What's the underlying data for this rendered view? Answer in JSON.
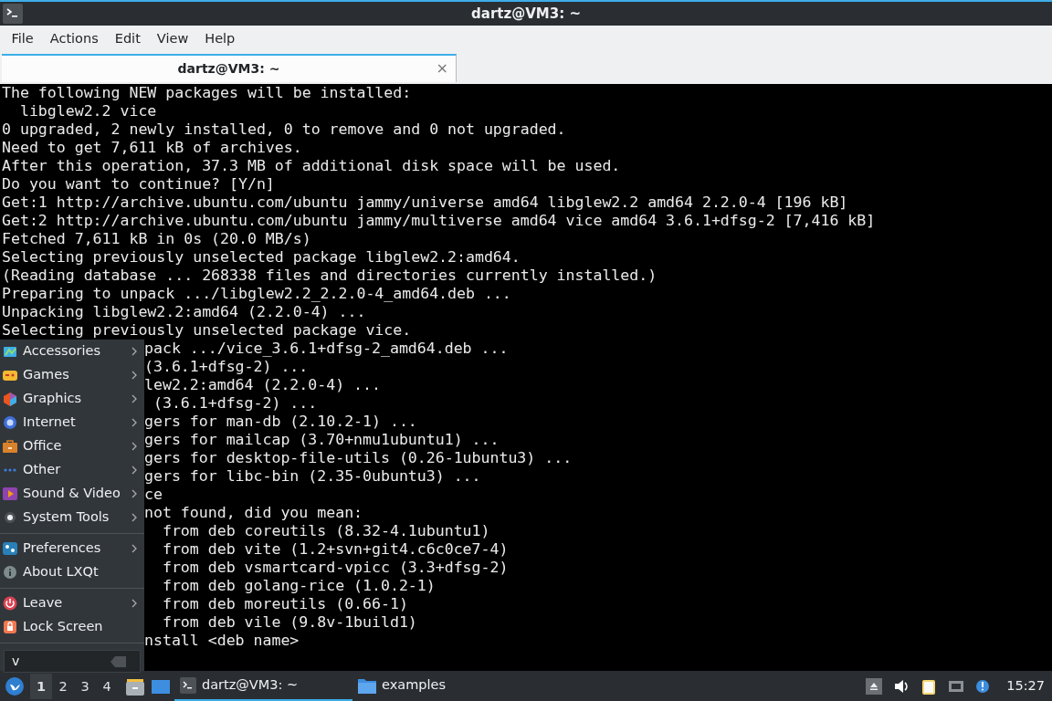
{
  "window": {
    "title": "dartz@VM3: ~"
  },
  "menubar": [
    "File",
    "Actions",
    "Edit",
    "View",
    "Help"
  ],
  "tabs": [
    {
      "label": "dartz@VM3: ~",
      "selected": true,
      "close": "×"
    }
  ],
  "terminal": {
    "lines": [
      "The following NEW packages will be installed:",
      "  libglew2.2 vice",
      "0 upgraded, 2 newly installed, 0 to remove and 0 not upgraded.",
      "Need to get 7,611 kB of archives.",
      "After this operation, 37.3 MB of additional disk space will be used.",
      "Do you want to continue? [Y/n]",
      "Get:1 http://archive.ubuntu.com/ubuntu jammy/universe amd64 libglew2.2 amd64 2.2.0-4 [196 kB]",
      "Get:2 http://archive.ubuntu.com/ubuntu jammy/multiverse amd64 vice amd64 3.6.1+dfsg-2 [7,416 kB]",
      "Fetched 7,611 kB in 0s (20.0 MB/s)",
      "Selecting previously unselected package libglew2.2:amd64.",
      "(Reading database ... 268338 files and directories currently installed.)",
      "Preparing to unpack .../libglew2.2_2.2.0-4_amd64.deb ...",
      "Unpacking libglew2.2:amd64 (2.2.0-4) ...",
      "Selecting previously unselected package vice."
    ],
    "partly_covered_lines": [
      "pack .../vice_3.6.1+dfsg-2_amd64.deb ...",
      "(3.6.1+dfsg-2) ...",
      "lew2.2:amd64 (2.2.0-4) ...",
      " (3.6.1+dfsg-2) ...",
      "gers for man-db (2.10.2-1) ...",
      "gers for mailcap (3.70+nmu1ubuntu1) ...",
      "gers for desktop-file-utils (0.26-1ubuntu3) ...",
      "gers for libc-bin (2.35-0ubuntu3) ...",
      "ce",
      "not found, did you mean:",
      "  from deb coreutils (8.32-4.1ubuntu1)",
      "  from deb vite (1.2+svn+git4.c6c0ce7-4)",
      "  from deb vsmartcard-vpicc (3.3+dfsg-2)",
      "  from deb golang-rice (1.0.2-1)",
      "  from deb moreutils (0.66-1)",
      "  from deb vile (9.8v-1build1)",
      "nstall <deb name>"
    ]
  },
  "start_menu": {
    "sections": [
      {
        "items": [
          {
            "label": "Accessories",
            "submenu": true
          },
          {
            "label": "Games",
            "submenu": true
          },
          {
            "label": "Graphics",
            "submenu": true
          },
          {
            "label": "Internet",
            "submenu": true
          },
          {
            "label": "Office",
            "submenu": true
          },
          {
            "label": "Other",
            "submenu": true
          },
          {
            "label": "Sound & Video",
            "submenu": true
          },
          {
            "label": "System Tools",
            "submenu": true
          }
        ]
      },
      {
        "items": [
          {
            "label": "Preferences",
            "submenu": true
          },
          {
            "label": "About LXQt",
            "submenu": false
          }
        ]
      },
      {
        "items": [
          {
            "label": "Leave",
            "submenu": true
          },
          {
            "label": "Lock Screen",
            "submenu": false
          }
        ]
      }
    ],
    "search": {
      "value": "v"
    }
  },
  "taskbar": {
    "workspaces": [
      {
        "label": "1",
        "selected": true
      },
      {
        "label": "2",
        "selected": false
      },
      {
        "label": "3",
        "selected": false
      },
      {
        "label": "4",
        "selected": false
      }
    ],
    "tasks": [
      {
        "label": "dartz@VM3: ~",
        "kind": "terminal",
        "selected": true
      },
      {
        "label": "examples",
        "kind": "folder",
        "selected": false
      }
    ],
    "clock": "15:27"
  }
}
